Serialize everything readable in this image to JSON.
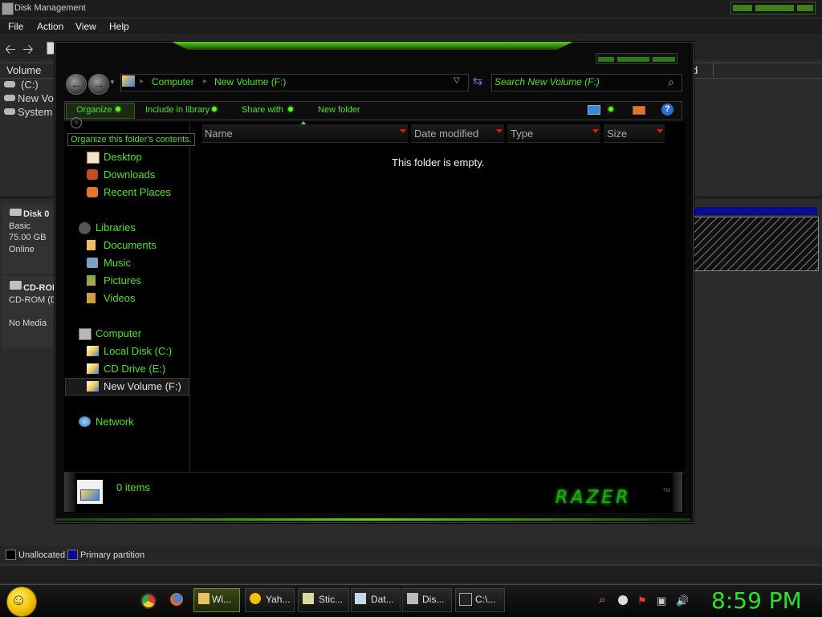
{
  "disk_management": {
    "title": "Disk Management",
    "menu": [
      "File",
      "Action",
      "View",
      "Help"
    ],
    "column_volume": "Volume",
    "column_d": "d",
    "volumes": [
      "(C:)",
      "New Vo",
      "System"
    ],
    "disk0": {
      "name": "Disk 0",
      "type": "Basic",
      "size": "75.00 GB",
      "status": "Online"
    },
    "cdrom": {
      "name": "CD-ROM",
      "drive": "CD-ROM (D:",
      "media": "No Media"
    },
    "legend": {
      "unallocated": "Unallocated",
      "primary": "Primary partition"
    },
    "colors": {
      "unallocated": "#000000",
      "primary": "#0a0a8c"
    }
  },
  "explorer": {
    "address": {
      "crumbs": [
        "Computer",
        "New Volume (F:)"
      ]
    },
    "search": {
      "placeholder": "Search New Volume (F:)"
    },
    "commands": {
      "organize": "Organize",
      "include": "Include in library",
      "share": "Share with",
      "new_folder": "New folder"
    },
    "tooltip": "Organize this folder's contents.",
    "nav": {
      "desktop": "Desktop",
      "downloads": "Downloads",
      "recent": "Recent Places",
      "libraries": "Libraries",
      "documents": "Documents",
      "music": "Music",
      "pictures": "Pictures",
      "videos": "Videos",
      "computer": "Computer",
      "local_disk": "Local Disk (C:)",
      "cd_drive": "CD Drive (E:)",
      "new_volume": "New Volume (F:)",
      "network": "Network"
    },
    "columns": {
      "name": "Name",
      "date": "Date modified",
      "type": "Type",
      "size": "Size"
    },
    "empty_message": "This folder is empty.",
    "details": {
      "count": "0 items",
      "logo": "RAZER"
    },
    "accent_color": "#4ee12a"
  },
  "taskbar": {
    "tasks": [
      "Wi...",
      "Yah...",
      "Stic...",
      "Dat...",
      "Dis...",
      "C:\\..."
    ],
    "clock": "8:59 PM"
  }
}
